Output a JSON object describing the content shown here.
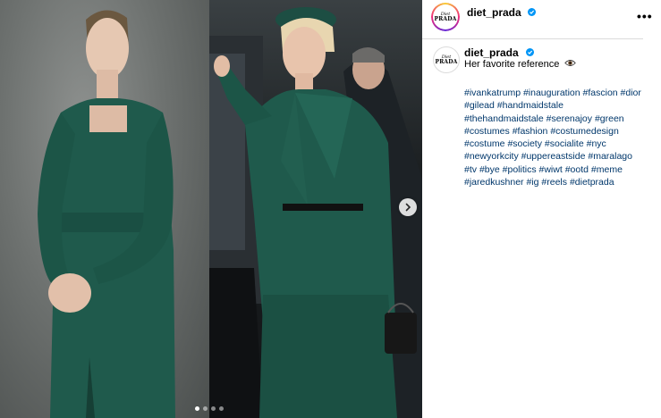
{
  "post": {
    "username": "diet_prada",
    "logo_top": "Diet",
    "logo_bottom": "PRADA",
    "more_label": "•••",
    "caption": "Her favorite reference",
    "caption_emoji": "eye",
    "hashtags": [
      "#ivankatrump",
      "#inauguration",
      "#fascion",
      "#dior",
      "#gilead",
      "#handmaidstale",
      "#thehandmaidstale",
      "#serenajoy",
      "#green",
      "#costumes",
      "#fashion",
      "#costumedesign",
      "#costume",
      "#society",
      "#socialite",
      "#nyc",
      "#newyorkcity",
      "#uppereastside",
      "#maralago",
      "#tv",
      "#bye",
      "#politics",
      "#wiwt",
      "#ootd",
      "#meme",
      "#jaredkushner",
      "#ig",
      "#reels",
      "#dietprada"
    ]
  },
  "carousel": {
    "slide_count": 4,
    "active_index": 0
  },
  "colors": {
    "link": "#00376b",
    "verified": "#0095f6",
    "divider": "#dbdbdb",
    "dress_green": "#1f5a4c"
  }
}
